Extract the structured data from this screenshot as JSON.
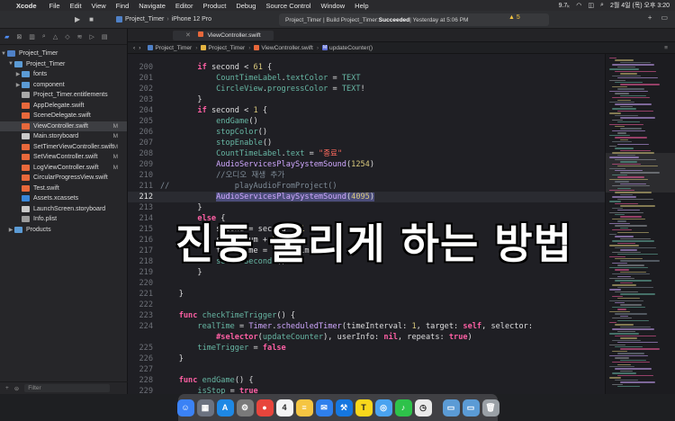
{
  "menubar": {
    "apple": "",
    "items": [
      "Xcode",
      "File",
      "Edit",
      "View",
      "Find",
      "Navigate",
      "Editor",
      "Product",
      "Debug",
      "Source Control",
      "Window",
      "Help"
    ],
    "status": [
      "9.7ₖ",
      "2월 4일 (목) 오후 3:20"
    ]
  },
  "toolbar": {
    "scheme": "Project_Timer",
    "device": "iPhone 12 Pro",
    "activity_prefix": "Project_Timer | Build Project_Timer: ",
    "activity_status": "Succeeded",
    "activity_time": " | Yesterday at 5:06 PM",
    "warnings": "▲ 5"
  },
  "navigator": {
    "project": "Project_Timer",
    "group": "Project_Timer",
    "items": [
      {
        "label": "fonts",
        "kind": "folder",
        "disclosure": "▶",
        "badge": ""
      },
      {
        "label": "component",
        "kind": "folder",
        "disclosure": "▶",
        "badge": ""
      },
      {
        "label": "Project_Timer.entitlements",
        "kind": "ent",
        "disclosure": "",
        "badge": ""
      },
      {
        "label": "AppDelegate.swift",
        "kind": "swift",
        "disclosure": "",
        "badge": ""
      },
      {
        "label": "SceneDelegate.swift",
        "kind": "swift",
        "disclosure": "",
        "badge": ""
      },
      {
        "label": "ViewController.swift",
        "kind": "swift",
        "disclosure": "",
        "badge": "M"
      },
      {
        "label": "Main.storyboard",
        "kind": "story",
        "disclosure": "",
        "badge": "M"
      },
      {
        "label": "SetTimerViewController.swift",
        "kind": "swift",
        "disclosure": "",
        "badge": "M"
      },
      {
        "label": "SetViewController.swift",
        "kind": "swift",
        "disclosure": "",
        "badge": "M"
      },
      {
        "label": "LogViewController.swift",
        "kind": "swift",
        "disclosure": "",
        "badge": "M"
      },
      {
        "label": "CircularProgressView.swift",
        "kind": "swift",
        "disclosure": "",
        "badge": ""
      },
      {
        "label": "Test.swift",
        "kind": "swift",
        "disclosure": "",
        "badge": ""
      },
      {
        "label": "Assets.xcassets",
        "kind": "assets",
        "disclosure": "",
        "badge": ""
      },
      {
        "label": "LaunchScreen.storyboard",
        "kind": "story",
        "disclosure": "",
        "badge": ""
      },
      {
        "label": "Info.plist",
        "kind": "plist",
        "disclosure": "",
        "badge": ""
      },
      {
        "label": "Products",
        "kind": "folder",
        "disclosure": "▶",
        "badge": ""
      }
    ],
    "filter_placeholder": "Filter"
  },
  "editor": {
    "tab_label": "ViewController.swift",
    "jumpbar": [
      "Project_Timer",
      "Project_Timer",
      "ViewController.swift",
      "updateCounter()"
    ],
    "current_line": 212
  },
  "code_lines": [
    {
      "n": "200",
      "html": "        <span class='kw'>if</span> second &lt; <span class='num-l'>61</span> {"
    },
    {
      "n": "201",
      "html": "            <span class='prop'>CountTimeLabel</span>.<span class='prop'>textColor</span> = <span class='prop'>TEXT</span>"
    },
    {
      "n": "202",
      "html": "            <span class='prop'>CircleView</span>.<span class='prop'>progressColor</span> = <span class='prop'>TEXT</span>!"
    },
    {
      "n": "203",
      "html": "        }"
    },
    {
      "n": "204",
      "html": "        <span class='kw'>if</span> second &lt; <span class='num-l'>1</span> {"
    },
    {
      "n": "205",
      "html": "            <span class='fn'>endGame</span>()"
    },
    {
      "n": "206",
      "html": "            <span class='fn'>stopColor</span>()"
    },
    {
      "n": "207",
      "html": "            <span class='fn'>stopEnable</span>()"
    },
    {
      "n": "208",
      "html": "            <span class='prop'>CountTimeLabel</span>.<span class='prop'>text</span> = <span class='str'>\"종료\"</span>"
    },
    {
      "n": "209",
      "html": "            <span class='type'>AudioServicesPlaySystemSound</span>(<span class='num-l'>1254</span>)"
    },
    {
      "n": "210",
      "html": "            <span class='cm'>//오디오 재생 추가</span>"
    },
    {
      "n": "211",
      "html": "<span class='cm'>//              playAudioFromProject()</span>"
    },
    {
      "n": "212",
      "html": "            <span class='sel-text'><span class='type'>AudioServicesPlaySystemSound</span>(<span class='num-l'>4095</span>)</span>"
    },
    {
      "n": "213",
      "html": "        }"
    },
    {
      "n": "214",
      "html": "        <span class='kw'>else</span> {"
    },
    {
      "n": "215",
      "html": "            second = second - <span class='num-l'>1</span>"
    },
    {
      "n": "216",
      "html": "            sum = sum + <span class='num-l'>1</span>"
    },
    {
      "n": "217",
      "html": "            totalTime = totalTime + <span class='num-l'>1</span>"
    },
    {
      "n": "218",
      "html": "            <span class='fn'>setPerSeconds</span>()"
    },
    {
      "n": "219",
      "html": "        }"
    },
    {
      "n": "220",
      "html": ""
    },
    {
      "n": "221",
      "html": "    }"
    },
    {
      "n": "222",
      "html": ""
    },
    {
      "n": "223",
      "html": "    <span class='kw'>func</span> <span class='fn'>checkTimeTrigger</span>() {"
    },
    {
      "n": "224",
      "html": "        <span class='prop'>realTime</span> = <span class='type'>Timer</span>.<span class='type'>scheduledTimer</span>(timeInterval: <span class='num-l'>1</span>, target: <span class='kw'>self</span>, selector:"
    },
    {
      "n": "",
      "html": "            <span class='kw'>#selector</span>(<span class='fn'>updateCounter</span>), userInfo: <span class='kw'>nil</span>, repeats: <span class='kw'>true</span>)"
    },
    {
      "n": "225",
      "html": "        <span class='prop'>timeTrigger</span> = <span class='kw'>false</span>"
    },
    {
      "n": "226",
      "html": "    }"
    },
    {
      "n": "227",
      "html": ""
    },
    {
      "n": "228",
      "html": "    <span class='kw'>func</span> <span class='fn'>endGame</span>() {"
    },
    {
      "n": "229",
      "html": "        <span class='prop'>isStop</span> = <span class='kw'>true</span>"
    }
  ],
  "overlay_title": "진동 울리게 하는 방법",
  "dock": {
    "apps": [
      {
        "name": "finder",
        "color": "#3b82f6",
        "glyph": "☺"
      },
      {
        "name": "launchpad",
        "color": "#6b7280",
        "glyph": "▦"
      },
      {
        "name": "app-store",
        "color": "#1e88e5",
        "glyph": "A"
      },
      {
        "name": "system-preferences",
        "color": "#7a7a7a",
        "glyph": "⚙"
      },
      {
        "name": "chrome",
        "color": "#e8453c",
        "glyph": "●"
      },
      {
        "name": "calendar",
        "color": "#f4f4f4",
        "glyph": "4"
      },
      {
        "name": "notes",
        "color": "#f5c542",
        "glyph": "≡"
      },
      {
        "name": "mail",
        "color": "#2f80ed",
        "glyph": "✉"
      },
      {
        "name": "xcode",
        "color": "#1577e0",
        "glyph": "⚒"
      },
      {
        "name": "kakaotalk",
        "color": "#f9d71c",
        "glyph": "T"
      },
      {
        "name": "safari",
        "color": "#4aa3f0",
        "glyph": "◎"
      },
      {
        "name": "music",
        "color": "#2ec24a",
        "glyph": "♪"
      },
      {
        "name": "clock",
        "color": "#eaeaea",
        "glyph": "◷"
      },
      {
        "name": "folder",
        "color": "#5b9bd5",
        "glyph": "▭"
      },
      {
        "name": "downloads",
        "color": "#5b9bd5",
        "glyph": "▭"
      },
      {
        "name": "trash",
        "color": "#9aa0a6",
        "glyph": "🗑"
      }
    ]
  }
}
